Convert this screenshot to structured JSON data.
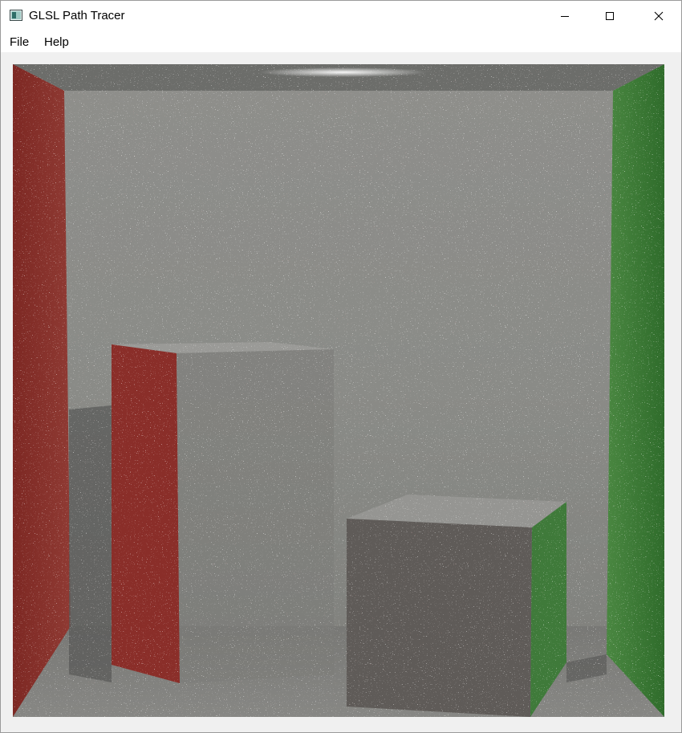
{
  "window": {
    "title": "GLSL Path Tracer",
    "controls": {
      "minimize_icon": "minimize-icon",
      "maximize_icon": "maximize-icon",
      "close_icon": "close-icon"
    }
  },
  "menu": {
    "items": [
      {
        "label": "File"
      },
      {
        "label": "Help"
      }
    ]
  },
  "render_view": {
    "scene": "cornell-box",
    "colors": {
      "left_wall": "#8a2f2a",
      "right_wall": "#3c7a34",
      "back_wall": "#8f8f8a",
      "floor": "#7d7d79",
      "ceiling": "#6e6e6c",
      "light": "#ffffff"
    }
  }
}
